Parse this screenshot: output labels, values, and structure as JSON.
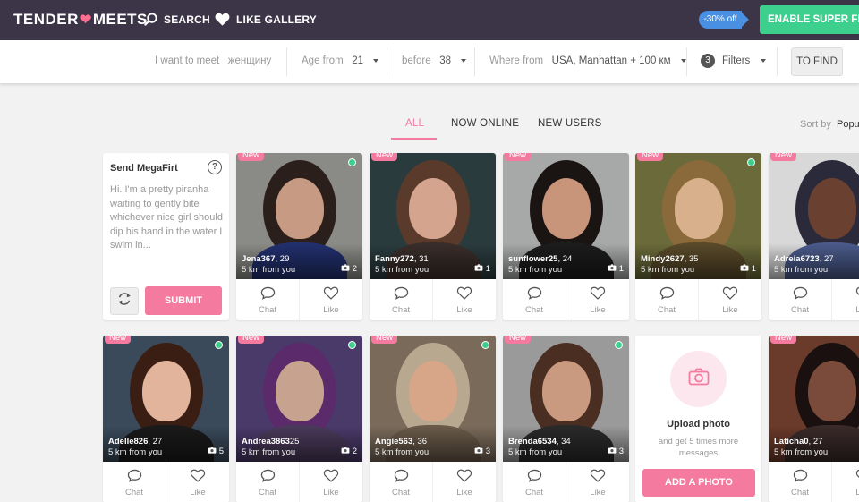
{
  "header": {
    "logo_left": "TENDER",
    "logo_right": "MEETS",
    "search_label": "SEARCH",
    "gallery_label": "LIKE GALLERY",
    "promo_label": "-30% off",
    "superflirt_label": "ENABLE SUPER FLIRT"
  },
  "filters": {
    "meet_label": "I want to meet",
    "meet_value": "женщину",
    "age_from_label": "Age from",
    "age_from_value": "21",
    "before_label": "before",
    "before_value": "38",
    "where_label": "Where from",
    "where_value": "USA, Manhattan + 100 км",
    "filters_count": "3",
    "filters_label": "Filters",
    "find_label": "TO FIND"
  },
  "tabs": [
    {
      "label": "ALL",
      "active": true
    },
    {
      "label": "NOW ONLINE",
      "active": false
    },
    {
      "label": "NEW USERS",
      "active": false
    }
  ],
  "sort": {
    "label": "Sort by",
    "value": "Popu"
  },
  "megaflirt": {
    "title": "Send MegaFirt",
    "help": "?",
    "message": "Hi. I'm a pretty piranha waiting to gently bite whichever nice girl should dip his hand in the water I swim in...",
    "submit_label": "SUBMIT"
  },
  "card_labels": {
    "new": "New",
    "chat": "Chat",
    "like": "Like"
  },
  "profiles": [
    {
      "name": "Jena367",
      "age": ", 29",
      "distance": "5 km from you",
      "photos": "2",
      "online": true,
      "colors": {
        "bg": "#8a8a86",
        "hair": "#2a1f1a",
        "skin": "#c79a84",
        "top": "#22306e"
      }
    },
    {
      "name": "Fanny272",
      "age": ", 31",
      "distance": "5 km from you",
      "photos": "1",
      "online": false,
      "colors": {
        "bg": "#2a3b3e",
        "hair": "#5a3a2a",
        "skin": "#d4a48e",
        "top": "#3a2e2a"
      }
    },
    {
      "name": "sunflower25",
      "age": ", 24",
      "distance": "5 km from you",
      "photos": "1",
      "online": false,
      "colors": {
        "bg": "#a7a9a9",
        "hair": "#1a1412",
        "skin": "#c8947a",
        "top": "#1c1c1c"
      }
    },
    {
      "name": "Mindy2627",
      "age": ", 35",
      "distance": "5 km from you",
      "photos": "1",
      "online": true,
      "colors": {
        "bg": "#6a6a3a",
        "hair": "#8a6a3a",
        "skin": "#d9b08c",
        "top": "#5a4a2a"
      }
    },
    {
      "name": "Adreia6723",
      "age": ", 27",
      "distance": "5 km from you",
      "photos": "",
      "online": false,
      "colors": {
        "bg": "#d8d8d8",
        "hair": "#2a2a3a",
        "skin": "#6a4030",
        "top": "#4a5a8a"
      }
    },
    {
      "name": "Adelle826",
      "age": ", 27",
      "distance": "5 km from you",
      "photos": "5",
      "online": true,
      "colors": {
        "bg": "#3a4a5a",
        "hair": "#3a1e14",
        "skin": "#e2b49c",
        "top": "#1a1a1a"
      }
    },
    {
      "name": "Andrea3863",
      "age": "25",
      "distance": "5 km from you",
      "photos": "2",
      "online": true,
      "colors": {
        "bg": "#4a3a6a",
        "hair": "#5a2a6a",
        "skin": "#c7a28e",
        "top": "#4a3a5a"
      }
    },
    {
      "name": "Angie563",
      "age": ", 36",
      "distance": "5 km from you",
      "photos": "3",
      "online": true,
      "colors": {
        "bg": "#7a6a5a",
        "hair": "#b8a890",
        "skin": "#d7a688",
        "top": "#6a5a4a"
      }
    },
    {
      "name": "Brenda6534",
      "age": ", 34",
      "distance": "5 km from you",
      "photos": "3",
      "online": true,
      "colors": {
        "bg": "#9a9a9a",
        "hair": "#4a2e22",
        "skin": "#c99a80",
        "top": "#2a2a2a"
      }
    },
    {
      "name": "Laticha0",
      "age": ", 27",
      "distance": "5 km from you",
      "photos": "",
      "online": false,
      "colors": {
        "bg": "#6a3a2a",
        "hair": "#1a1010",
        "skin": "#7a4a3a",
        "top": "#3a2a2a"
      }
    }
  ],
  "upload": {
    "title": "Upload photo",
    "subtitle": "and get 5 times more messages",
    "button_label": "ADD A PHOTO"
  },
  "colors": {
    "header_bg": "#3b3547",
    "accent_pink": "#f47aa0",
    "online_green": "#3dcf8e",
    "promo_blue": "#4a90e2"
  }
}
